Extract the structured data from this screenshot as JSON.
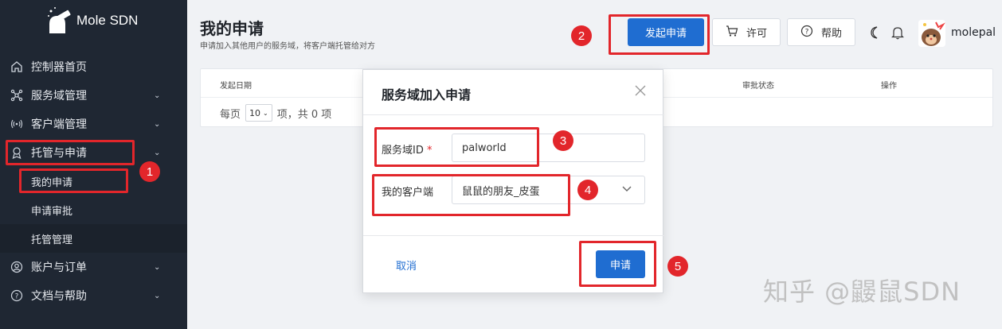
{
  "app": {
    "logo_text": "Mole SDN"
  },
  "sidebar": {
    "items": [
      {
        "label": "控制器首页",
        "icon": "home-icon"
      },
      {
        "label": "服务域管理",
        "icon": "network-icon"
      },
      {
        "label": "客户端管理",
        "icon": "signal-icon"
      },
      {
        "label": "托管与申请",
        "icon": "award-icon"
      },
      {
        "label": "账户与订单",
        "icon": "user-circle-icon"
      },
      {
        "label": "文档与帮助",
        "icon": "help-circle-icon"
      }
    ],
    "sub_items": [
      {
        "label": "我的申请"
      },
      {
        "label": "申请审批"
      },
      {
        "label": "托管管理"
      }
    ]
  },
  "header": {
    "title": "我的申请",
    "description": "申请加入其他用户的服务域，将客户端托管给对方",
    "primary_button": "发起申请",
    "license_button": "许可",
    "help_button": "帮助",
    "username": "molepal"
  },
  "table": {
    "columns": [
      "发起日期",
      "审批状态",
      "操作"
    ],
    "pager": {
      "per_page_label": "每页",
      "per_page_value": "10",
      "total_text": "项，共 0 项"
    }
  },
  "modal": {
    "title": "服务域加入申请",
    "fields": [
      {
        "label": "服务域ID",
        "required_mark": "*",
        "value": "palworld"
      },
      {
        "label": "我的客户端",
        "value": "鼠鼠的朋友_皮蛋"
      }
    ],
    "cancel_label": "取消",
    "submit_label": "申请"
  },
  "annotations": [
    "1",
    "2",
    "3",
    "4",
    "5"
  ],
  "watermark": "知乎 @鼹鼠SDN",
  "colors": {
    "sidebar_bg": "#1f2733",
    "primary": "#1f6dd1",
    "annotation_red": "#e2262b"
  }
}
